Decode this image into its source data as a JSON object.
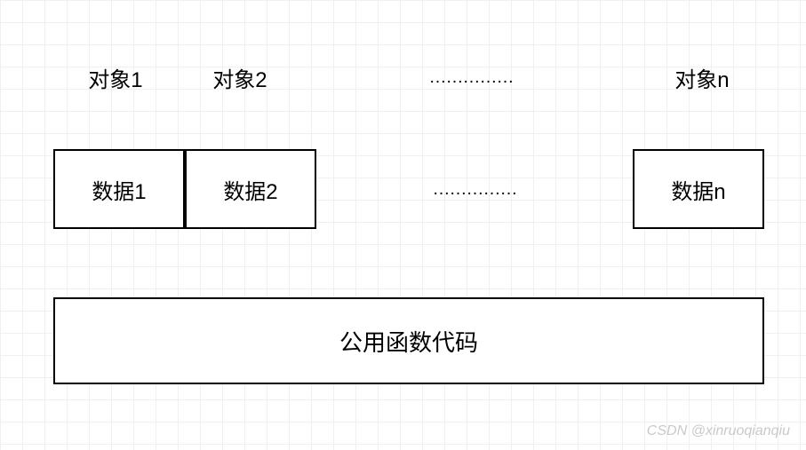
{
  "labels": {
    "obj1": "对象1",
    "obj2": "对象2",
    "ellipsis": "……………",
    "objn": "对象n"
  },
  "data_boxes": {
    "data1": "数据1",
    "data2": "数据2",
    "ellipsis": "……………",
    "datan": "数据n"
  },
  "shared_box": "公用函数代码",
  "watermark": "CSDN @xinruoqianqiu"
}
